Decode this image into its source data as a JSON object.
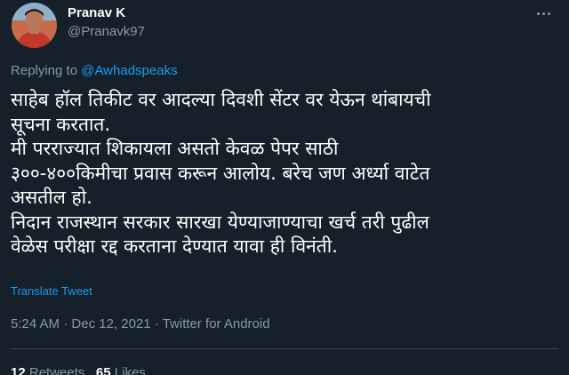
{
  "author": {
    "display_name": "Pranav K",
    "handle": "@Pranavk97",
    "avatar_icon": "profile-photo-icon"
  },
  "reply": {
    "prefix": "Replying to ",
    "target": "@Awhadspeaks"
  },
  "tweet": {
    "lines": [
      "साहेब हॉल तिकीट वर आदल्या दिवशी सेंटर वर येऊन थांबायची",
      "सूचना करतात.",
      "मी परराज्यात शिकायला असतो केवळ पेपर साठी",
      "३००-४००किमीचा प्रवास करून आलोय. बरेच जण अर्ध्या वाटेत",
      "असतील हो.",
      "निदान राजस्थान सरकार सारखा येण्याजाण्याचा खर्च तरी पुढील",
      "वेळेस परीक्षा रद्द करताना देण्यात यावा ही विनंती."
    ],
    "translate_label": "Translate Tweet"
  },
  "meta": {
    "time": "5:24 AM",
    "separator": " · ",
    "date": "Dec 12, 2021",
    "source": "Twitter for Android"
  },
  "stats": {
    "retweets_count": "12",
    "retweets_label": "Retweets",
    "likes_count": "65",
    "likes_label": "Likes"
  },
  "colors": {
    "background": "#15202b",
    "text": "#ffffff",
    "secondary": "#8899a6",
    "accent": "#1d9bf0",
    "divider": "#38444d"
  }
}
